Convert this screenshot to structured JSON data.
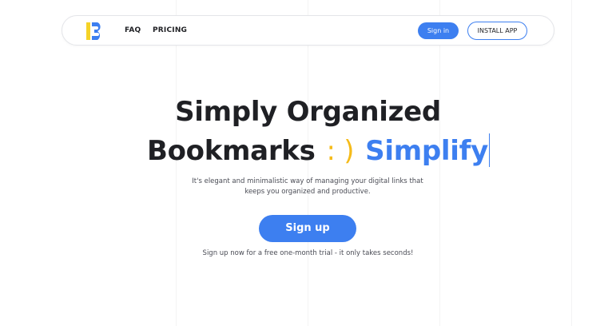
{
  "nav": {
    "links": [
      "FAQ",
      "PRICING"
    ],
    "signin_label": "Sign in",
    "install_label": "INSTALL APP"
  },
  "logo": {
    "icon": "logo-b-icon",
    "colors": {
      "yellow": "#f5d327",
      "blue": "#3d7ff0"
    }
  },
  "hero": {
    "headline_line1": "Simply Organized",
    "headline_word": "Bookmarks",
    "smile": ": )",
    "typed_word": "Simplify",
    "subtitle_line1": "It's elegant and minimalistic way of managing your digital links that",
    "subtitle_line2": "keeps you organized and productive.",
    "signup_label": "Sign up",
    "trial_note": "Sign up now for a free one-month trial - it only takes seconds!"
  },
  "colors": {
    "accent": "#3d7ff0",
    "smile": "#f5bb1a",
    "text": "#1f2024"
  }
}
